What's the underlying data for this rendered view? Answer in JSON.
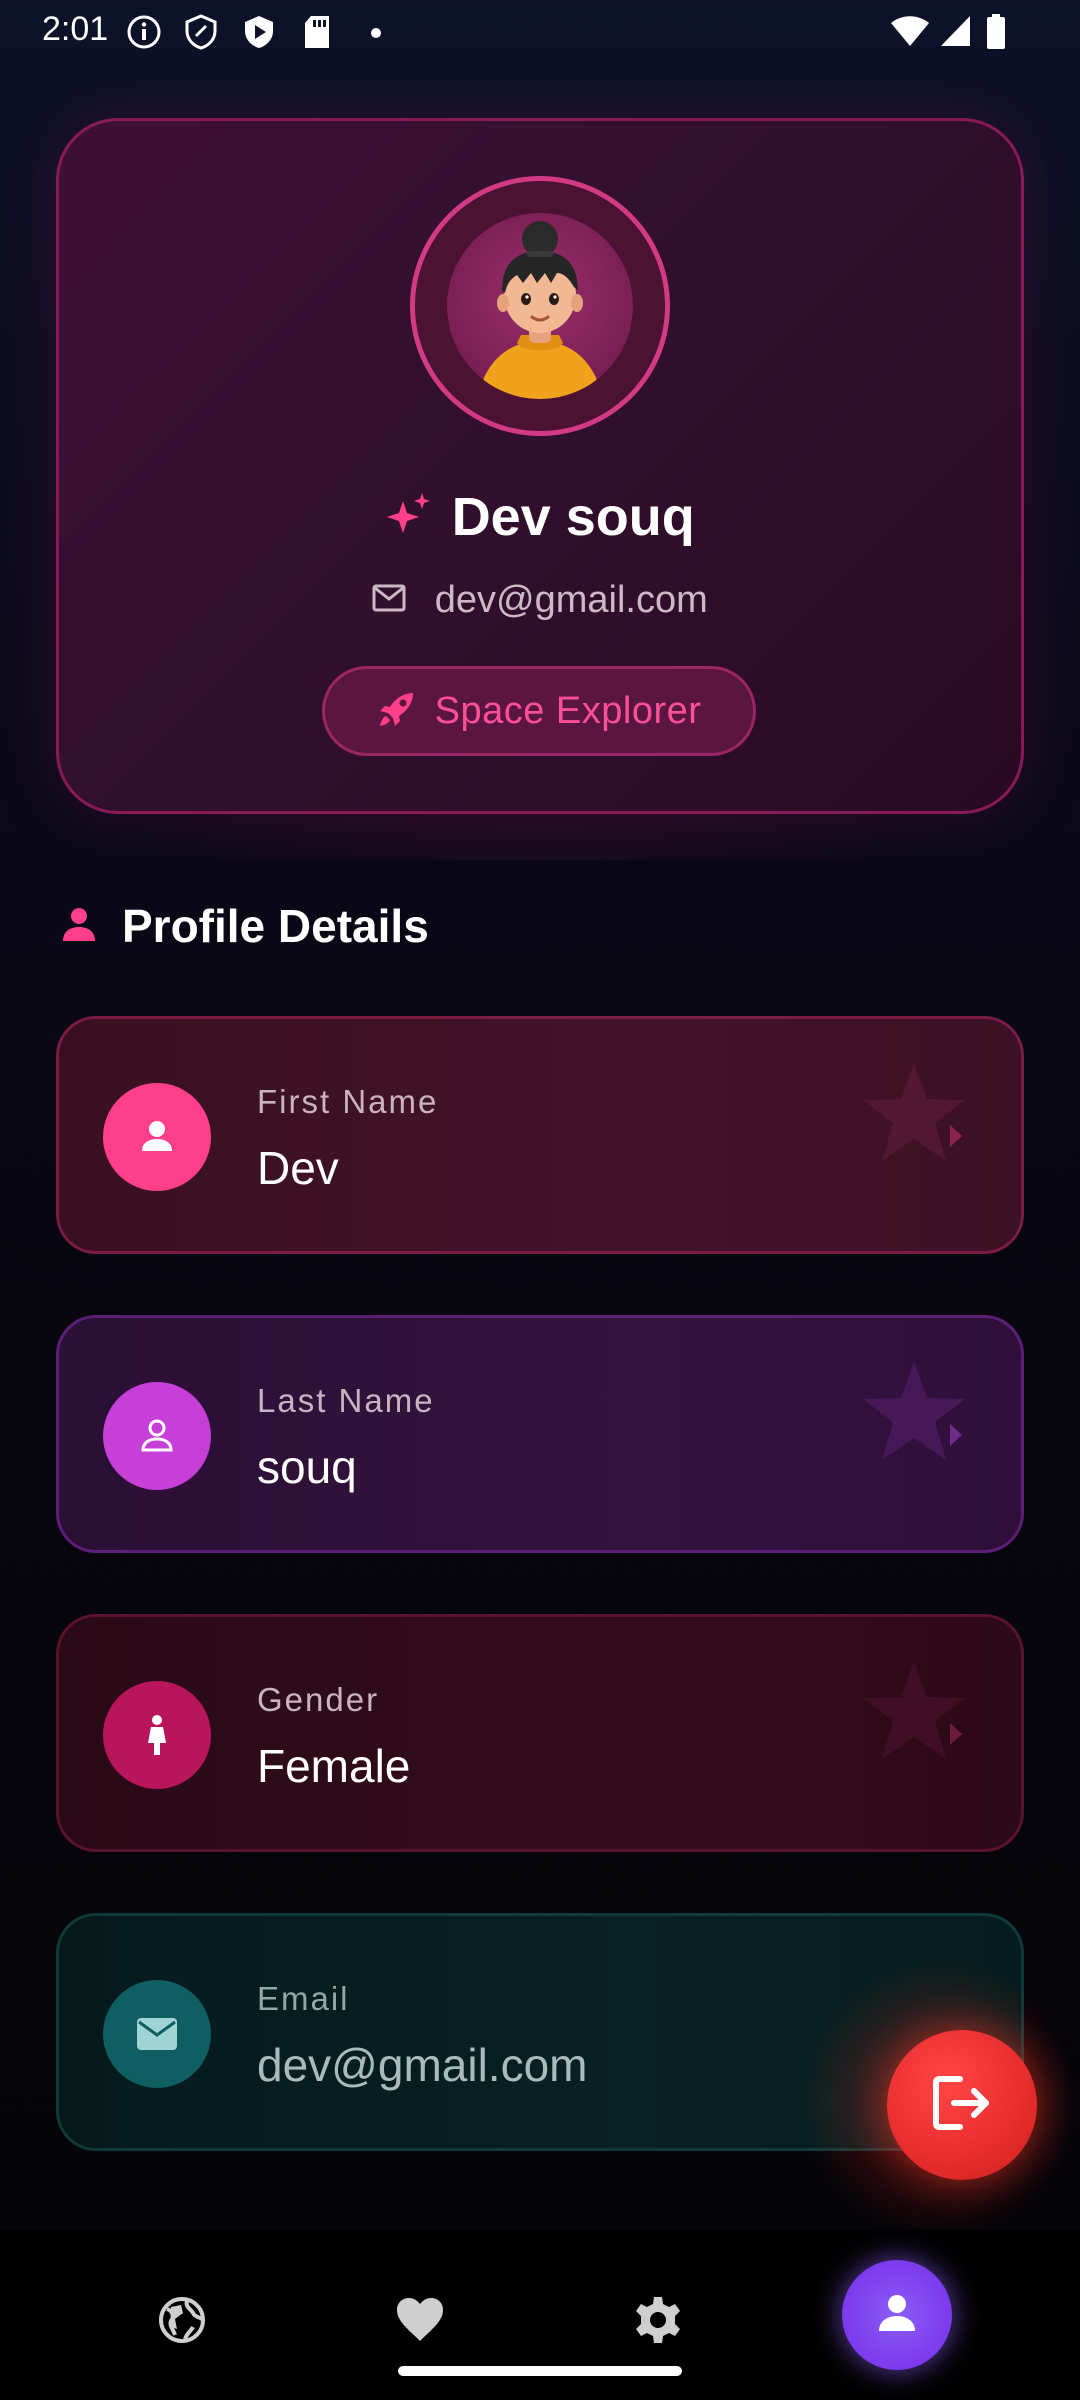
{
  "status_bar": {
    "time": "2:01",
    "icons_left": [
      "info-icon",
      "shield-icon",
      "play-protect-icon",
      "sd-card-icon",
      "dot-icon"
    ],
    "icons_right": [
      "wifi-icon",
      "signal-icon",
      "battery-icon"
    ]
  },
  "profile_header": {
    "name": "Dev souq",
    "email": "dev@gmail.com",
    "badge_label": "Space Explorer",
    "badge_icon": "rocket-icon",
    "name_icon": "sparkle-icon"
  },
  "section": {
    "title": "Profile Details",
    "icon": "person-icon"
  },
  "details": [
    {
      "label": "First Name",
      "value": "Dev",
      "icon": "person-icon",
      "color": "#ff3f8a"
    },
    {
      "label": "Last Name",
      "value": "souq",
      "icon": "person-outline-icon",
      "color": "#c63fd6"
    },
    {
      "label": "Gender",
      "value": "Female",
      "icon": "female-icon",
      "color": "#b8155c"
    },
    {
      "label": "Email",
      "value": "dev@gmail.com",
      "icon": "mail-icon",
      "color": "#0e6f73"
    }
  ],
  "logout": {
    "icon": "logout-icon"
  },
  "bottom_nav": {
    "items": [
      "globe-icon",
      "heart-icon",
      "settings-icon",
      "profile-icon"
    ],
    "active": "profile-icon",
    "active_color": "#7c3aed"
  }
}
